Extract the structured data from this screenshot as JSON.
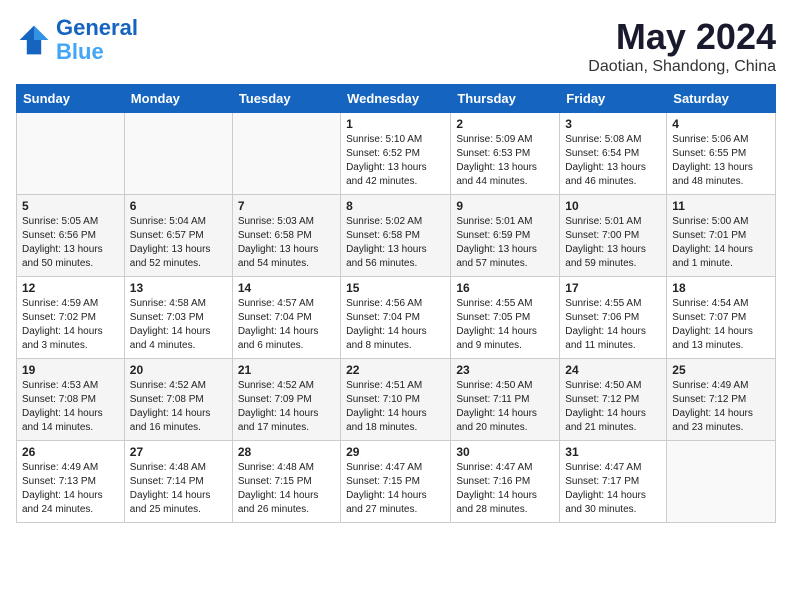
{
  "header": {
    "logo_line1": "General",
    "logo_line2": "Blue",
    "month_title": "May 2024",
    "location": "Daotian, Shandong, China"
  },
  "weekdays": [
    "Sunday",
    "Monday",
    "Tuesday",
    "Wednesday",
    "Thursday",
    "Friday",
    "Saturday"
  ],
  "weeks": [
    [
      {
        "day": "",
        "info": ""
      },
      {
        "day": "",
        "info": ""
      },
      {
        "day": "",
        "info": ""
      },
      {
        "day": "1",
        "info": "Sunrise: 5:10 AM\nSunset: 6:52 PM\nDaylight: 13 hours\nand 42 minutes."
      },
      {
        "day": "2",
        "info": "Sunrise: 5:09 AM\nSunset: 6:53 PM\nDaylight: 13 hours\nand 44 minutes."
      },
      {
        "day": "3",
        "info": "Sunrise: 5:08 AM\nSunset: 6:54 PM\nDaylight: 13 hours\nand 46 minutes."
      },
      {
        "day": "4",
        "info": "Sunrise: 5:06 AM\nSunset: 6:55 PM\nDaylight: 13 hours\nand 48 minutes."
      }
    ],
    [
      {
        "day": "5",
        "info": "Sunrise: 5:05 AM\nSunset: 6:56 PM\nDaylight: 13 hours\nand 50 minutes."
      },
      {
        "day": "6",
        "info": "Sunrise: 5:04 AM\nSunset: 6:57 PM\nDaylight: 13 hours\nand 52 minutes."
      },
      {
        "day": "7",
        "info": "Sunrise: 5:03 AM\nSunset: 6:58 PM\nDaylight: 13 hours\nand 54 minutes."
      },
      {
        "day": "8",
        "info": "Sunrise: 5:02 AM\nSunset: 6:58 PM\nDaylight: 13 hours\nand 56 minutes."
      },
      {
        "day": "9",
        "info": "Sunrise: 5:01 AM\nSunset: 6:59 PM\nDaylight: 13 hours\nand 57 minutes."
      },
      {
        "day": "10",
        "info": "Sunrise: 5:01 AM\nSunset: 7:00 PM\nDaylight: 13 hours\nand 59 minutes."
      },
      {
        "day": "11",
        "info": "Sunrise: 5:00 AM\nSunset: 7:01 PM\nDaylight: 14 hours\nand 1 minute."
      }
    ],
    [
      {
        "day": "12",
        "info": "Sunrise: 4:59 AM\nSunset: 7:02 PM\nDaylight: 14 hours\nand 3 minutes."
      },
      {
        "day": "13",
        "info": "Sunrise: 4:58 AM\nSunset: 7:03 PM\nDaylight: 14 hours\nand 4 minutes."
      },
      {
        "day": "14",
        "info": "Sunrise: 4:57 AM\nSunset: 7:04 PM\nDaylight: 14 hours\nand 6 minutes."
      },
      {
        "day": "15",
        "info": "Sunrise: 4:56 AM\nSunset: 7:04 PM\nDaylight: 14 hours\nand 8 minutes."
      },
      {
        "day": "16",
        "info": "Sunrise: 4:55 AM\nSunset: 7:05 PM\nDaylight: 14 hours\nand 9 minutes."
      },
      {
        "day": "17",
        "info": "Sunrise: 4:55 AM\nSunset: 7:06 PM\nDaylight: 14 hours\nand 11 minutes."
      },
      {
        "day": "18",
        "info": "Sunrise: 4:54 AM\nSunset: 7:07 PM\nDaylight: 14 hours\nand 13 minutes."
      }
    ],
    [
      {
        "day": "19",
        "info": "Sunrise: 4:53 AM\nSunset: 7:08 PM\nDaylight: 14 hours\nand 14 minutes."
      },
      {
        "day": "20",
        "info": "Sunrise: 4:52 AM\nSunset: 7:08 PM\nDaylight: 14 hours\nand 16 minutes."
      },
      {
        "day": "21",
        "info": "Sunrise: 4:52 AM\nSunset: 7:09 PM\nDaylight: 14 hours\nand 17 minutes."
      },
      {
        "day": "22",
        "info": "Sunrise: 4:51 AM\nSunset: 7:10 PM\nDaylight: 14 hours\nand 18 minutes."
      },
      {
        "day": "23",
        "info": "Sunrise: 4:50 AM\nSunset: 7:11 PM\nDaylight: 14 hours\nand 20 minutes."
      },
      {
        "day": "24",
        "info": "Sunrise: 4:50 AM\nSunset: 7:12 PM\nDaylight: 14 hours\nand 21 minutes."
      },
      {
        "day": "25",
        "info": "Sunrise: 4:49 AM\nSunset: 7:12 PM\nDaylight: 14 hours\nand 23 minutes."
      }
    ],
    [
      {
        "day": "26",
        "info": "Sunrise: 4:49 AM\nSunset: 7:13 PM\nDaylight: 14 hours\nand 24 minutes."
      },
      {
        "day": "27",
        "info": "Sunrise: 4:48 AM\nSunset: 7:14 PM\nDaylight: 14 hours\nand 25 minutes."
      },
      {
        "day": "28",
        "info": "Sunrise: 4:48 AM\nSunset: 7:15 PM\nDaylight: 14 hours\nand 26 minutes."
      },
      {
        "day": "29",
        "info": "Sunrise: 4:47 AM\nSunset: 7:15 PM\nDaylight: 14 hours\nand 27 minutes."
      },
      {
        "day": "30",
        "info": "Sunrise: 4:47 AM\nSunset: 7:16 PM\nDaylight: 14 hours\nand 28 minutes."
      },
      {
        "day": "31",
        "info": "Sunrise: 4:47 AM\nSunset: 7:17 PM\nDaylight: 14 hours\nand 30 minutes."
      },
      {
        "day": "",
        "info": ""
      }
    ]
  ]
}
